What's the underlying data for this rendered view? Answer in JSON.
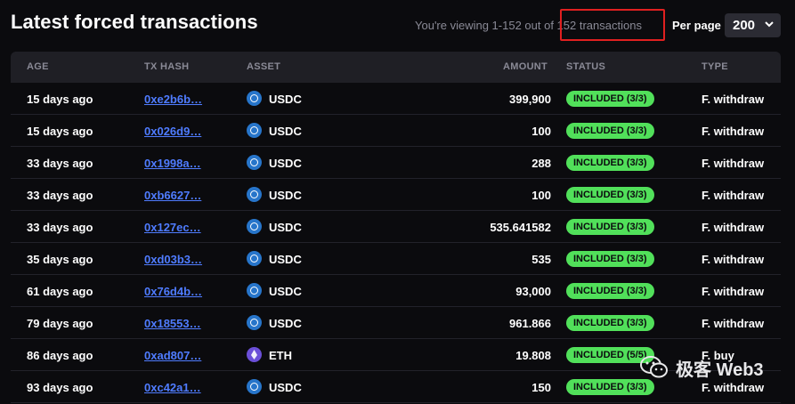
{
  "page": {
    "title": "Latest forced transactions",
    "viewing": "You're viewing 1-152 out of 152 transactions",
    "per_page_label": "Per page",
    "per_page_value": "200"
  },
  "columns": [
    "AGE",
    "TX HASH",
    "ASSET",
    "AMOUNT",
    "STATUS",
    "TYPE"
  ],
  "rows": [
    {
      "age": "15 days ago",
      "hash": "0xe2b6b…",
      "asset": "USDC",
      "amount": "399,900",
      "status": "INCLUDED (3/3)",
      "type": "F. withdraw"
    },
    {
      "age": "15 days ago",
      "hash": "0x026d9…",
      "asset": "USDC",
      "amount": "100",
      "status": "INCLUDED (3/3)",
      "type": "F. withdraw"
    },
    {
      "age": "33 days ago",
      "hash": "0x1998a…",
      "asset": "USDC",
      "amount": "288",
      "status": "INCLUDED (3/3)",
      "type": "F. withdraw"
    },
    {
      "age": "33 days ago",
      "hash": "0xb6627…",
      "asset": "USDC",
      "amount": "100",
      "status": "INCLUDED (3/3)",
      "type": "F. withdraw"
    },
    {
      "age": "33 days ago",
      "hash": "0x127ec…",
      "asset": "USDC",
      "amount": "535.641582",
      "status": "INCLUDED (3/3)",
      "type": "F. withdraw"
    },
    {
      "age": "35 days ago",
      "hash": "0xd03b3…",
      "asset": "USDC",
      "amount": "535",
      "status": "INCLUDED (3/3)",
      "type": "F. withdraw"
    },
    {
      "age": "61 days ago",
      "hash": "0x76d4b…",
      "asset": "USDC",
      "amount": "93,000",
      "status": "INCLUDED (3/3)",
      "type": "F. withdraw"
    },
    {
      "age": "79 days ago",
      "hash": "0x18553…",
      "asset": "USDC",
      "amount": "961.866",
      "status": "INCLUDED (3/3)",
      "type": "F. withdraw"
    },
    {
      "age": "86 days ago",
      "hash": "0xad807…",
      "asset": "ETH",
      "amount": "19.808",
      "status": "INCLUDED (5/5)",
      "type": "F. buy"
    },
    {
      "age": "93 days ago",
      "hash": "0xc42a1…",
      "asset": "USDC",
      "amount": "150",
      "status": "INCLUDED (3/3)",
      "type": "F. withdraw"
    }
  ],
  "watermark": {
    "text": "极客 Web3"
  },
  "colors": {
    "background": "#0b0b0e",
    "header_bg": "#1f1f25",
    "link": "#4f7cff",
    "status_green": "#51e05a",
    "highlight": "#e02020"
  }
}
